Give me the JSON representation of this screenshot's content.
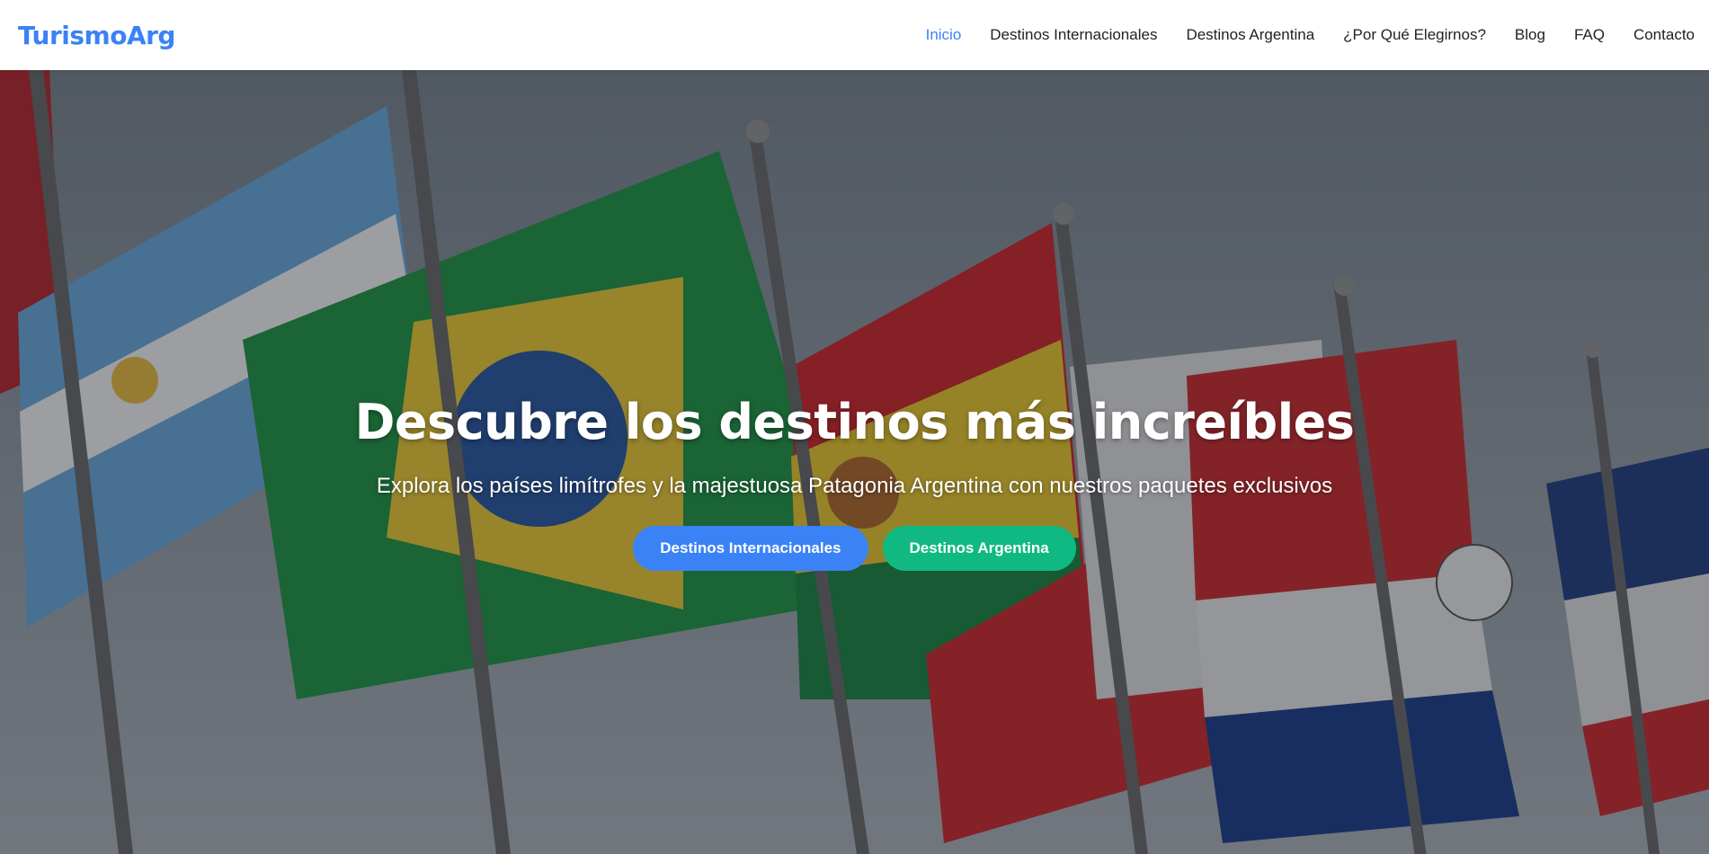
{
  "brand": "TurismoArg",
  "nav": {
    "items": [
      {
        "label": "Inicio",
        "active": true
      },
      {
        "label": "Destinos Internacionales",
        "active": false
      },
      {
        "label": "Destinos Argentina",
        "active": false
      },
      {
        "label": "¿Por Qué Elegirnos?",
        "active": false
      },
      {
        "label": "Blog",
        "active": false
      },
      {
        "label": "FAQ",
        "active": false
      },
      {
        "label": "Contacto",
        "active": false
      }
    ]
  },
  "hero": {
    "title": "Descubre los destinos más increíbles",
    "subtitle": "Explora los países limítrofes y la majestuosa Patagonia Argentina con nuestros paquetes exclusivos",
    "primary_button": "Destinos Internacionales",
    "secondary_button": "Destinos Argentina",
    "background": "flags of South American countries (Argentina, Brazil, Bolivia, Peru, Paraguay) on poles"
  },
  "colors": {
    "accent_blue": "#3b82f6",
    "accent_green": "#10b981",
    "nav_text": "#222222"
  }
}
